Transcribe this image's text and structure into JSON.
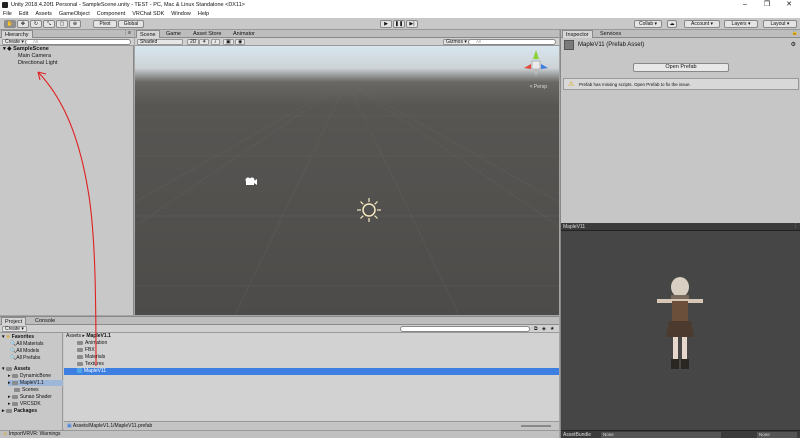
{
  "window": {
    "title": "Unity 2018.4.20f1 Personal - SampleScene.unity - TEST - PC, Mac & Linux Standalone <DX11>",
    "controls": [
      "–",
      "❐",
      "✕"
    ]
  },
  "menu": [
    "File",
    "Edit",
    "Assets",
    "GameObject",
    "Component",
    "VRChat SDK",
    "Window",
    "Help"
  ],
  "toolbar": {
    "pivot": "Pivot",
    "global": "Global",
    "collab": "Collab ▾",
    "account": "Account ▾",
    "layers": "Layers ▾",
    "layout": "Layout ▾"
  },
  "hierarchy": {
    "tab": "Hierarchy",
    "create": "Create ▾",
    "search_placeholder": "All",
    "scene": "SampleScene",
    "items": [
      "Main Camera",
      "Directional Light"
    ]
  },
  "scene": {
    "tabs": [
      "Scene",
      "Game",
      "Asset Store",
      "Animator"
    ],
    "shading": "Shaded",
    "mode2d": "2D",
    "gizmos": "Gizmos ▾",
    "search_placeholder": "All",
    "persp": "< Persp"
  },
  "inspector": {
    "tabs": [
      "Inspector",
      "Services"
    ],
    "object_name": "MapleV11 (Prefab Asset)",
    "open_prefab": "Open Prefab",
    "warning": "Prefab has missing scripts. Open Prefab to fix the issue."
  },
  "preview": {
    "title": "MapleV11",
    "assetbundle_label": "AssetBundle",
    "assetbundle_value": "None",
    "variant_value": "None"
  },
  "project": {
    "tabs": [
      "Project",
      "Console"
    ],
    "create": "Create ▾",
    "tree": {
      "favorites": "Favorites",
      "fav_items": [
        "All Materials",
        "All Models",
        "All Prefabs"
      ],
      "assets": "Assets",
      "asset_items": [
        "DynamicBone",
        "MapleV1.1",
        "Scenes",
        "Sunao Shader",
        "VRCSDK"
      ],
      "packages": "Packages"
    },
    "breadcrumb": [
      "Assets",
      "MapleV1.1"
    ],
    "files": [
      "Animation",
      "FBX",
      "Materials",
      "Textures",
      "MapleV11"
    ],
    "path": "Assets/MapleV1.1/MapleV11.prefab"
  },
  "status": {
    "text": "ImportVRVR: Warnings"
  },
  "colors": {
    "selection": "#3d7fe0",
    "annotation": "#e02020"
  }
}
